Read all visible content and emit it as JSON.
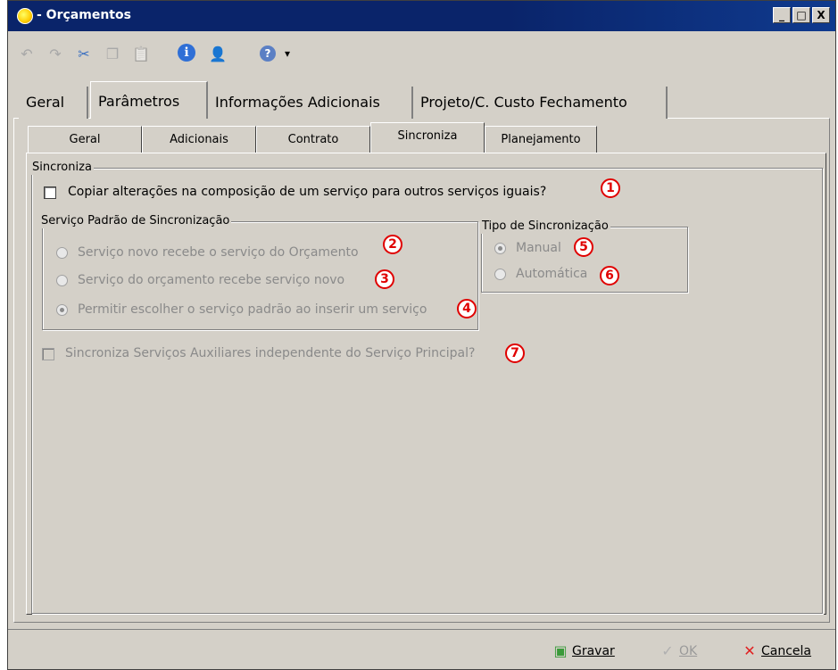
{
  "window": {
    "title": "- Orçamentos",
    "controls": {
      "minimize": "_",
      "maximize": "□",
      "close": "X"
    }
  },
  "toolbar": {
    "items": [
      {
        "name": "undo-icon",
        "glyph": "↶",
        "enabled": false
      },
      {
        "name": "redo-icon",
        "glyph": "↷",
        "enabled": false
      },
      {
        "name": "cut-icon",
        "glyph": "✂",
        "enabled": true
      },
      {
        "name": "copy-icon",
        "glyph": "❐",
        "enabled": false
      },
      {
        "name": "paste-icon",
        "glyph": "📋",
        "enabled": false
      },
      {
        "name": "info-icon",
        "glyph": "ℹ",
        "enabled": true
      },
      {
        "name": "user-icon",
        "glyph": "👤",
        "enabled": true
      },
      {
        "name": "help-icon",
        "glyph": "?",
        "enabled": true
      },
      {
        "name": "dropdown-arrow-icon",
        "glyph": "▾",
        "enabled": true
      }
    ]
  },
  "tabs_main": [
    {
      "label": "Geral",
      "active": false
    },
    {
      "label": "Parâmetros",
      "active": true
    },
    {
      "label": "Informações Adicionais",
      "active": false
    },
    {
      "label": "Projeto/C. Custo Fechamento",
      "active": false
    }
  ],
  "tabs_sub": [
    {
      "label": "Geral",
      "active": false
    },
    {
      "label": "Adicionais",
      "active": false
    },
    {
      "label": "Contrato",
      "active": false
    },
    {
      "label": "Sincroniza",
      "active": true
    },
    {
      "label": "Planejamento",
      "active": false
    }
  ],
  "sincroniza": {
    "group_label": "Sincroniza",
    "copy_checkbox": {
      "label": "Copiar alterações na composição de um serviço para outros serviços iguais?",
      "checked": false,
      "badge": "1"
    },
    "padrao_group": {
      "label": "Serviço Padrão de Sincronização",
      "options": [
        {
          "label": "Serviço novo recebe o serviço do Orçamento",
          "checked": false,
          "badge": "2"
        },
        {
          "label": "Serviço do orçamento recebe serviço novo",
          "checked": false,
          "badge": "3"
        },
        {
          "label": "Permitir escolher o serviço padrão ao inserir um serviço",
          "checked": true,
          "badge": "4"
        }
      ]
    },
    "tipo_group": {
      "label": "Tipo de Sincronização",
      "options": [
        {
          "label": "Manual",
          "checked": true,
          "badge": "5"
        },
        {
          "label": "Automática",
          "checked": false,
          "badge": "6"
        }
      ]
    },
    "aux_checkbox": {
      "label": "Sincroniza Serviços Auxiliares independente do Serviço Principal?",
      "checked": false,
      "badge": "7"
    }
  },
  "footer": {
    "save_label": "Gravar",
    "ok_label": "OK",
    "cancel_label": "Cancela"
  },
  "colors": {
    "badge": "#e00000",
    "titlebar": "#0a246a",
    "face": "#d4d0c8"
  }
}
